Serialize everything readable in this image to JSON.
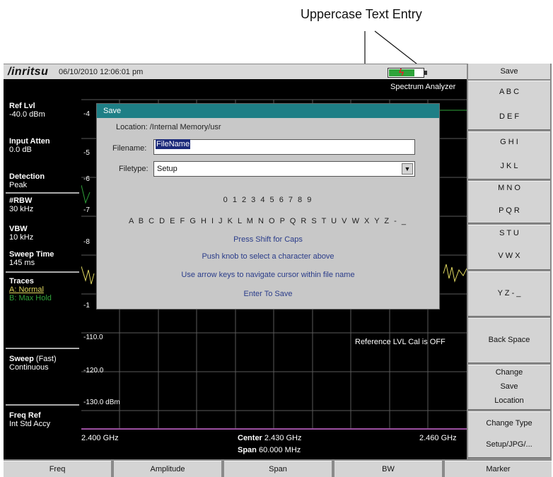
{
  "callout": {
    "text": "Uppercase Text Entry"
  },
  "header": {
    "logo": "/inritsu",
    "datetime": "06/10/2010 12:06:01 pm",
    "mode": "Spectrum Analyzer"
  },
  "left_panel": {
    "ref_lvl": {
      "label": "Ref Lvl",
      "value": "-40.0 dBm"
    },
    "input_atten": {
      "label": "Input Atten",
      "value": "0.0 dB"
    },
    "detection": {
      "label": "Detection",
      "value": "Peak"
    },
    "rbw": {
      "label": "#RBW",
      "value": "30 kHz"
    },
    "vbw": {
      "label": "VBW",
      "value": "10 kHz"
    },
    "sweep_time": {
      "label": "Sweep Time",
      "value": "145 ms"
    },
    "traces": {
      "label": "Traces",
      "a": "A: Normal",
      "b": "B: Max Hold"
    },
    "sweep": {
      "label": "Sweep",
      "mode": "(Fast)",
      "value": "Continuous"
    },
    "freq_ref": {
      "label": "Freq Ref",
      "value": "Int Std Accy"
    }
  },
  "graph": {
    "y_labels": [
      "-4",
      "-5",
      "-6",
      "-7",
      "-8",
      "-1",
      "-110.0",
      "-120.0",
      "-130.0 dBm"
    ],
    "ref_msg": "Reference LVL Cal is OFF",
    "x_start": "2.400 GHz",
    "x_end": "2.460 GHz",
    "center_label": "Center",
    "center_value": "2.430 GHz",
    "span_label": "Span",
    "span_value": "60.000 MHz"
  },
  "right_menu": {
    "title": "Save",
    "buttons": [
      {
        "line1": "A B C",
        "line2": "D E F"
      },
      {
        "line1": "G H I",
        "line2": "J K L"
      },
      {
        "line1": "M N O",
        "line2": "P Q R"
      },
      {
        "line1": "S T U",
        "line2": "V W X"
      },
      {
        "line1": "Y Z - _"
      },
      {
        "line1": "Back Space"
      },
      {
        "line1": "Change",
        "line2": "Save",
        "line3": "Location"
      },
      {
        "line1": "Change Type",
        "line2": "Setup/JPG/..."
      }
    ]
  },
  "bottom_tabs": [
    "Freq",
    "Amplitude",
    "Span",
    "BW",
    "Marker"
  ],
  "dialog": {
    "title": "Save",
    "location": "Location: /Internal Memory/usr",
    "filename_label": "Filename:",
    "filename_value": "FileName",
    "filetype_label": "Filetype:",
    "filetype_value": "Setup",
    "digits": "0 1 2 3 4 5 6 7 8 9",
    "letters": "A B C D E F G H I J K L M N O P Q R S T U V W X Y Z - _",
    "hints": [
      "Press Shift for Caps",
      "Push knob to select a character above",
      "Use arrow keys to navigate cursor within file name",
      "Enter To Save"
    ]
  },
  "colors": {
    "dialog_title_bg": "#1e7f86",
    "trace_a": "#e0d860",
    "trace_b": "#2fa33a",
    "marker_line": "#9b4fa0"
  }
}
